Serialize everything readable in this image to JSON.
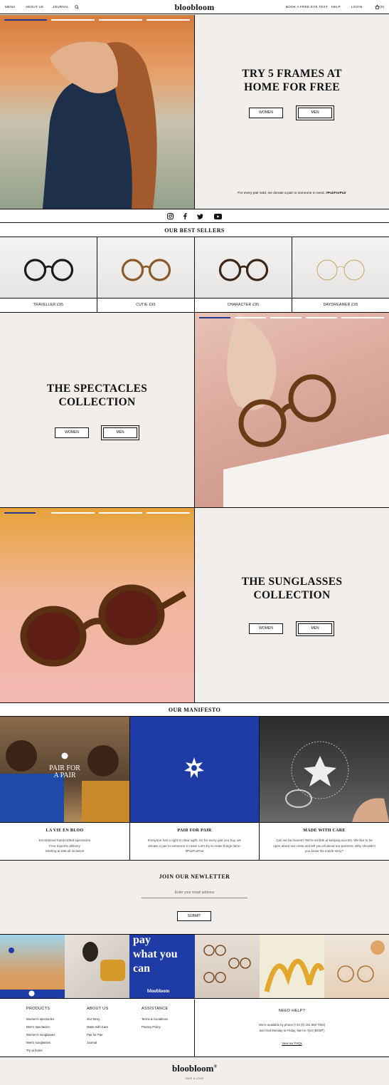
{
  "header": {
    "nav_left": [
      "MENU",
      "ABOUT US",
      "JOURNAL"
    ],
    "logo": "bloobloom",
    "nav_right": [
      "BOOK A FREE EYE TEST",
      "HELP",
      "LOGIN"
    ],
    "basket_count": "(0)"
  },
  "hero": {
    "title_line1": "TRY 5 FRAMES AT",
    "title_line2": "HOME FOR FREE",
    "women_label": "WOMEN",
    "men_label": "MEN",
    "donate_text": "For every pair sold, we donate a pair to someone in need.",
    "donate_tag": "#PairForPair"
  },
  "social": [
    "instagram-icon",
    "facebook-icon",
    "twitter-icon",
    "youtube-icon"
  ],
  "best_sellers": {
    "heading": "OUR BEST SELLERS",
    "items": [
      {
        "label": "TRAVELLER  £95",
        "frame": "#1b1b1b"
      },
      {
        "label": "CUTIE  £95",
        "frame": "#8a5a2b"
      },
      {
        "label": "CHARACTER  £95",
        "frame": "#3b2618"
      },
      {
        "label": "DAYDREAMER  £95",
        "frame": "#c6a46a"
      }
    ]
  },
  "spectacles": {
    "title_line1": "THE SPECTACLES",
    "title_line2": "COLLECTION",
    "women_label": "WOMEN",
    "men_label": "MEN"
  },
  "sunglasses": {
    "title_line1": "THE SUNGLASSES",
    "title_line2": "COLLECTION",
    "women_label": "WOMEN",
    "men_label": "MEN"
  },
  "manifesto": {
    "heading": "OUR MANIFESTO",
    "overlay_line1": "PAIR FOR",
    "overlay_line2": "A PAIR",
    "items": [
      {
        "title": "LA VIE EN BLOO",
        "text": "Exceptional handcrafted spectacles\nFree express delivery\nStarting at £95 all inclusive"
      },
      {
        "title": "PAIR FOR PAIR",
        "text": "Everyone has a right to clear sight. So for every pair you buy, we donate a pair to someone in need. Let's try to make things fairer. #PairForPair"
      },
      {
        "title": "MADE WITH CARE",
        "text": "Can we be honest? We're terrible at keeping secrets. We like to be open about our costs and tell you all about our partners. Why shouldn't you know the inside story?"
      }
    ]
  },
  "newsletter": {
    "heading": "JOIN OUR NEWLETTER",
    "placeholder": "Enter your email address",
    "submit_label": "SUBMIT"
  },
  "instagram_strip": {
    "poster_line1": "pay",
    "poster_line2": "what you",
    "poster_line3": "can",
    "poster_logo": "bloobloom"
  },
  "footer": {
    "products_heading": "PRODUCTS",
    "products": [
      "Women's spectacles",
      "Men's spectacles",
      "Women's sunglasses",
      "Men's sunglasses",
      "Try at home"
    ],
    "about_heading": "ABOUT US",
    "about": [
      "Our Story",
      "Made with Care",
      "Pair for Pair",
      "Journal"
    ],
    "assistance_heading": "ASSISTANCE",
    "assistance": [
      "Terms & Conditions",
      "Privacy Policy"
    ],
    "help_heading": "NEED HELP?",
    "help_text1": "We're available by phone (+44 (0) 161 850 7004)",
    "help_text2": "and chat Monday to Friday, 9am to 7pm (BGMT)",
    "faq_link": "View our FAQs",
    "bottom_logo": "bloobloom",
    "bottom_tag": "TAKE A LOOK"
  }
}
